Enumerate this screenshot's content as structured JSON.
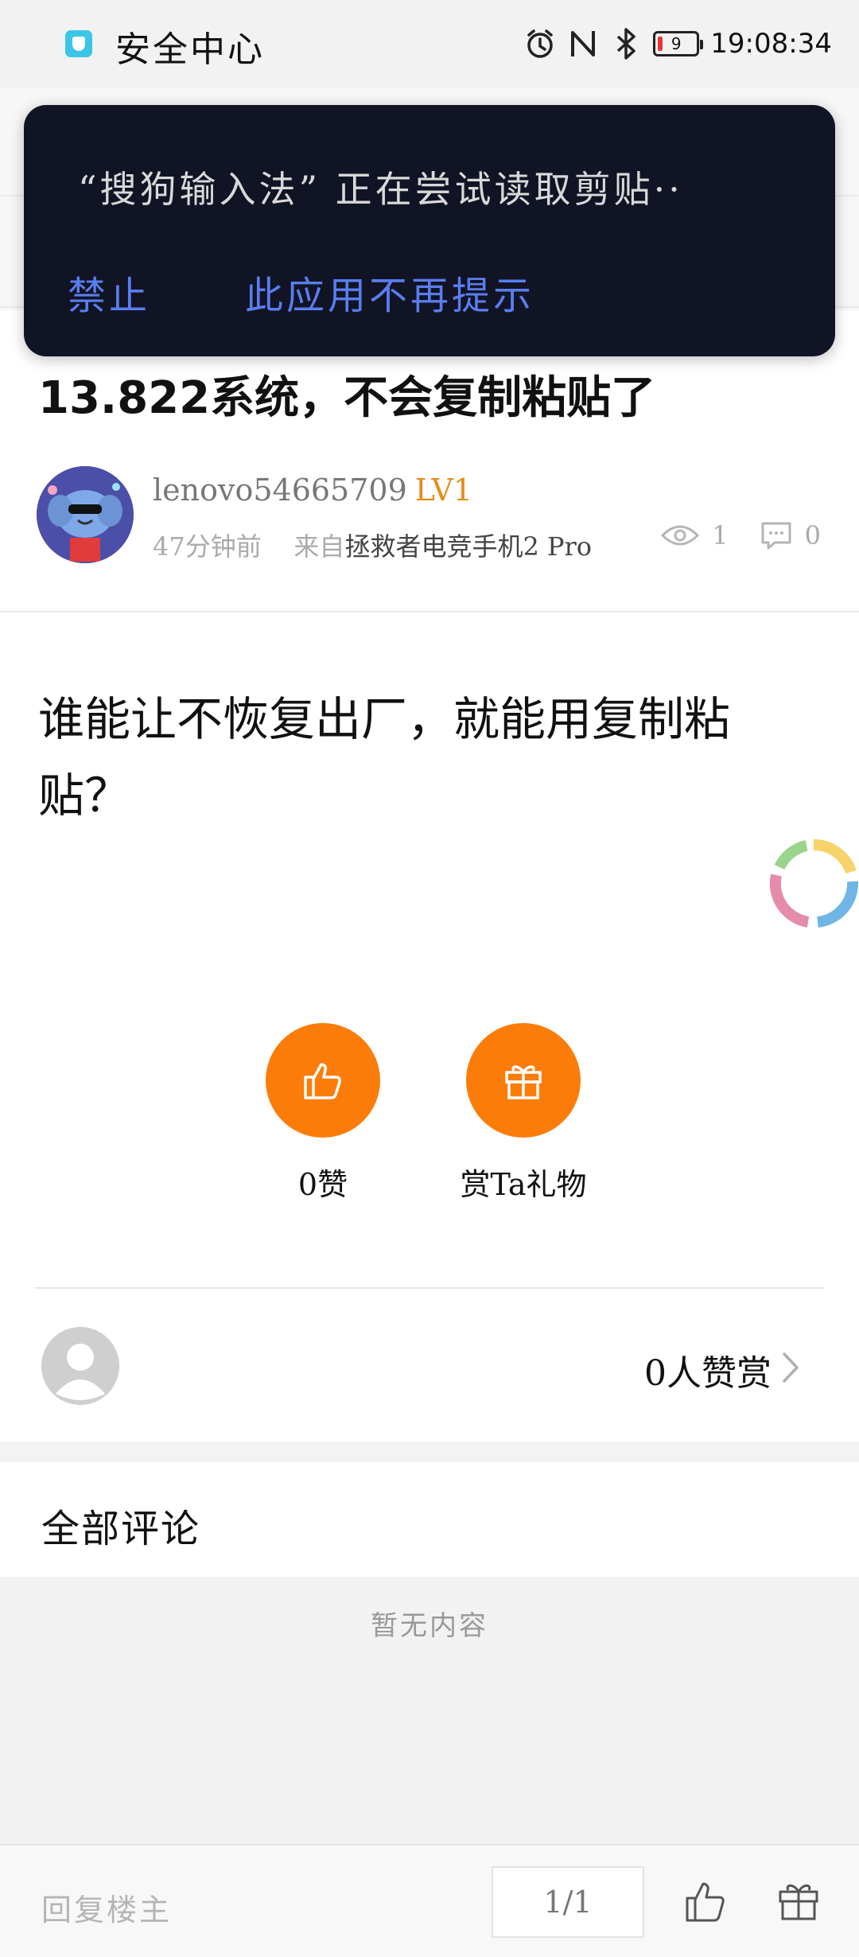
{
  "status_bar": {
    "app_name": "安全中心",
    "time": "19:08:34",
    "battery_level": "9"
  },
  "toast": {
    "message": "“搜狗输入法” 正在尝试读取剪贴··",
    "deny_label": "禁止",
    "dont_remind_label": "此应用不再提示"
  },
  "post": {
    "title": "13.822系统，不会复制粘贴了",
    "author": {
      "name": "lenovo54665709",
      "level": "LV1"
    },
    "time_ago": "47分钟前",
    "from_prefix": "来自",
    "device": "拯救者电竞手机2 Pro",
    "views": "1",
    "comments": "0",
    "body": "谁能让不恢复出厂，就能用复制粘贴？"
  },
  "actions": {
    "like_label": "0赞",
    "gift_label": "赏Ta礼物"
  },
  "reward": {
    "count_label": "0人赞赏"
  },
  "comments": {
    "title": "全部评论",
    "empty_text": "暂无内容"
  },
  "bottom_bar": {
    "reply_placeholder": "回复楼主",
    "page_indicator": "1/1"
  },
  "colors": {
    "accent_orange": "#fb7c09",
    "level_orange": "#e88c1a",
    "toast_bg": "#111424",
    "toast_button": "#5a7df0"
  }
}
